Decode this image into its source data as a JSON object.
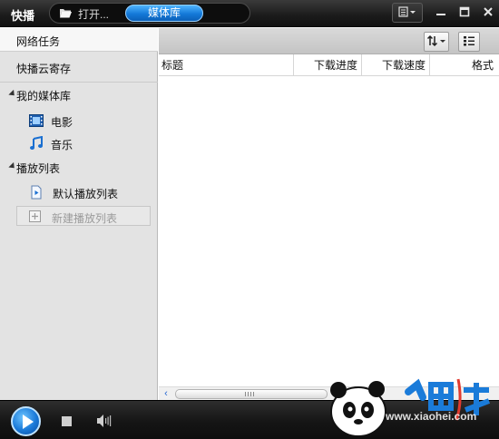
{
  "app": {
    "title": "快播"
  },
  "tabs": {
    "open_label": "打开...",
    "media_label": "媒体库"
  },
  "sidebar": {
    "items": [
      {
        "label": "网络任务"
      },
      {
        "label": "快播云寄存"
      }
    ],
    "media_library": {
      "label": "我的媒体库",
      "children": [
        {
          "label": "电影",
          "icon": "film-icon"
        },
        {
          "label": "音乐",
          "icon": "music-note-icon"
        }
      ]
    },
    "playlists": {
      "label": "播放列表",
      "children": [
        {
          "label": "默认播放列表",
          "icon": "playlist-file-icon"
        }
      ],
      "new_label": "新建播放列表"
    }
  },
  "table": {
    "columns": [
      "标题",
      "下载进度",
      "下载速度",
      "格式"
    ]
  },
  "watermark": {
    "text": "小黑游戏",
    "url": "www.xiaohei.com"
  },
  "colors": {
    "accent": "#1479d8",
    "dark": "#151515"
  }
}
